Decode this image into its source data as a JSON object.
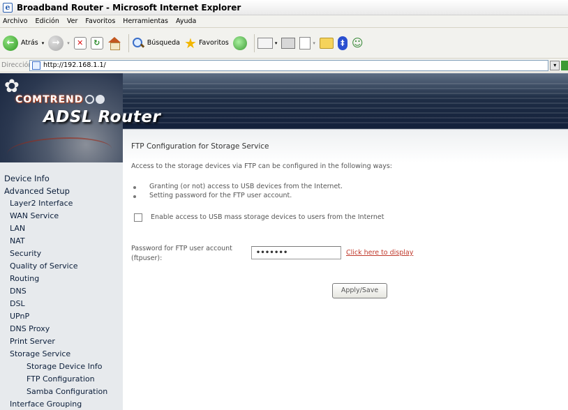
{
  "window": {
    "title": "Broadband Router - Microsoft Internet Explorer",
    "app_icon": "ie-icon"
  },
  "menubar": [
    "Archivo",
    "Edición",
    "Ver",
    "Favoritos",
    "Herramientas",
    "Ayuda"
  ],
  "toolbar": {
    "back_label": "Atrás",
    "search_label": "Búsqueda",
    "favorites_label": "Favoritos",
    "icons": [
      "back-icon",
      "forward-icon",
      "stop-icon",
      "refresh-icon",
      "home-icon",
      "search-icon",
      "favorites-star-icon",
      "history-icon",
      "mail-icon",
      "print-icon",
      "edit-icon",
      "folder-icon",
      "bluetooth-icon",
      "messenger-icon"
    ]
  },
  "addressbar": {
    "label": "Dirección",
    "url": "http://192.168.1.1/"
  },
  "banner": {
    "brand": "COMTREND",
    "product": "ADSL Router"
  },
  "sidebar": {
    "items": [
      {
        "label": "Device Info",
        "level": 0
      },
      {
        "label": "Advanced Setup",
        "level": 0
      },
      {
        "label": "Layer2 Interface",
        "level": 1
      },
      {
        "label": "WAN Service",
        "level": 1
      },
      {
        "label": "LAN",
        "level": 1
      },
      {
        "label": "NAT",
        "level": 1
      },
      {
        "label": "Security",
        "level": 1
      },
      {
        "label": "Quality of Service",
        "level": 1
      },
      {
        "label": "Routing",
        "level": 1
      },
      {
        "label": "DNS",
        "level": 1
      },
      {
        "label": "DSL",
        "level": 1
      },
      {
        "label": "UPnP",
        "level": 1
      },
      {
        "label": "DNS Proxy",
        "level": 1
      },
      {
        "label": "Print Server",
        "level": 1
      },
      {
        "label": "Storage Service",
        "level": 1
      },
      {
        "label": "Storage Device Info",
        "level": 2
      },
      {
        "label": "FTP Configuration",
        "level": 2
      },
      {
        "label": "Samba Configuration",
        "level": 2
      },
      {
        "label": "Interface Grouping",
        "level": 1
      }
    ]
  },
  "main": {
    "title": "FTP Configuration for Storage Service",
    "intro": "Access to the storage devices via FTP can be configured in the following ways:",
    "bullets": [
      "Granting (or not) access to USB devices from the Internet.",
      "Setting password for the FTP user account."
    ],
    "checkbox_label": "Enable access to USB mass storage devices to users from the Internet",
    "checkbox_checked": false,
    "password_label_line1": "Password for FTP user account",
    "password_label_line2": "(ftpuser):",
    "password_value": "•••••••",
    "display_link": "Click here to display",
    "apply_button": "Apply/Save"
  }
}
